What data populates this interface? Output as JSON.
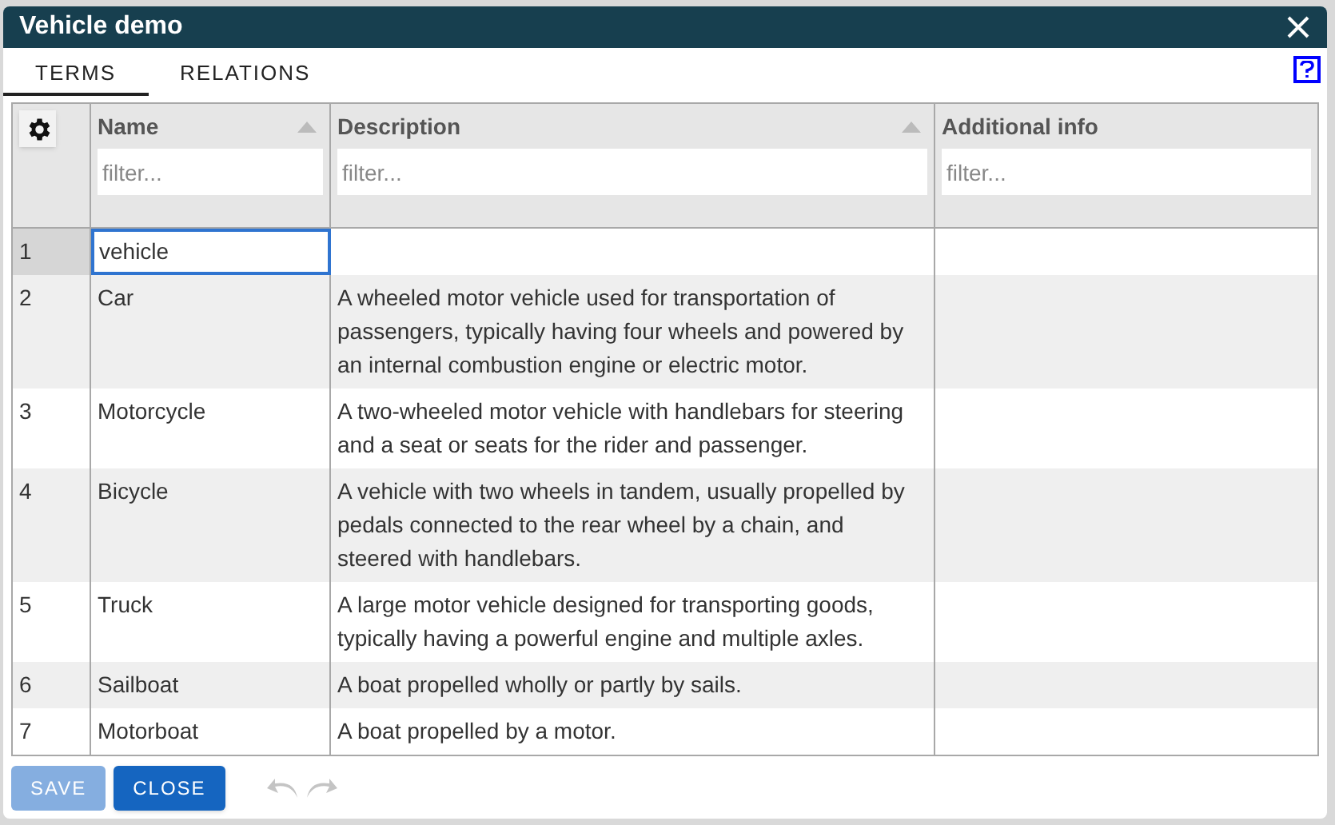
{
  "window": {
    "title": "Vehicle demo"
  },
  "tabs": [
    {
      "label": "TERMS",
      "selected": true
    },
    {
      "label": "RELATIONS",
      "selected": false
    }
  ],
  "table": {
    "columns": [
      {
        "label": "Name",
        "sortable": true,
        "placeholder": "filter..."
      },
      {
        "label": "Description",
        "sortable": true,
        "placeholder": "filter..."
      },
      {
        "label": "Additional info",
        "sortable": false,
        "placeholder": "filter..."
      }
    ],
    "rows": [
      {
        "number": "1",
        "name": "vehicle",
        "description": "",
        "selected": true
      },
      {
        "number": "2",
        "name": "Car",
        "description": "A wheeled motor vehicle used for transportation of passengers, typically having four wheels and powered by an internal combustion engine or electric motor.",
        "selected": false
      },
      {
        "number": "3",
        "name": "Motorcycle",
        "description": "A two-wheeled motor vehicle with handlebars for steering and a seat or seats for the rider and passenger.",
        "selected": false
      },
      {
        "number": "4",
        "name": "Bicycle",
        "description": "A vehicle with two wheels in tandem, usually propelled by pedals connected to the rear wheel by a chain, and steered with handlebars.",
        "selected": false
      },
      {
        "number": "5",
        "name": "Truck",
        "description": "A large motor vehicle designed for transporting goods, typically having a powerful engine and multiple axles.",
        "selected": false
      },
      {
        "number": "6",
        "name": "Sailboat",
        "description": "A boat propelled wholly or partly by sails.",
        "selected": false
      },
      {
        "number": "7",
        "name": "Motorboat",
        "description": "A boat propelled by a motor.",
        "selected": false
      }
    ]
  },
  "buttons": [
    {
      "label": "SAVE",
      "disabled": true
    },
    {
      "label": "CLOSE",
      "disabled": false
    }
  ],
  "history": {
    "undo_disabled": true,
    "redo_disabled": true
  }
}
